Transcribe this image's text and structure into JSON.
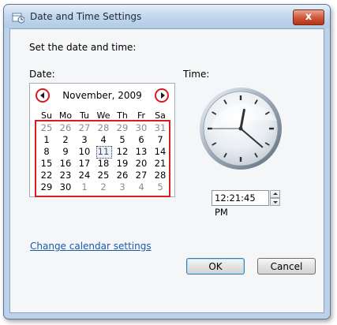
{
  "window": {
    "title": "Date and Time Settings",
    "close_label": "x"
  },
  "instruction": "Set the date and time:",
  "date_label": "Date:",
  "time_label": "Time:",
  "calendar": {
    "month": "November, 2009",
    "weekdays": [
      "Su",
      "Mo",
      "Tu",
      "We",
      "Th",
      "Fr",
      "Sa"
    ],
    "days": [
      [
        "25",
        "26",
        "27",
        "28",
        "29",
        "30",
        "31"
      ],
      [
        "1",
        "2",
        "3",
        "4",
        "5",
        "6",
        "7"
      ],
      [
        "8",
        "9",
        "10",
        "11",
        "12",
        "13",
        "14"
      ],
      [
        "15",
        "16",
        "17",
        "18",
        "19",
        "20",
        "21"
      ],
      [
        "22",
        "23",
        "24",
        "25",
        "26",
        "27",
        "28"
      ],
      [
        "29",
        "30",
        "1",
        "2",
        "3",
        "4",
        "5"
      ]
    ],
    "today": "11"
  },
  "time_value": "12:21:45 PM",
  "change_calendar_link": "Change calendar settings",
  "buttons": {
    "ok": "OK",
    "cancel": "Cancel"
  },
  "colors": {
    "highlight": "#d51f1f",
    "link": "#1a5aa8"
  }
}
